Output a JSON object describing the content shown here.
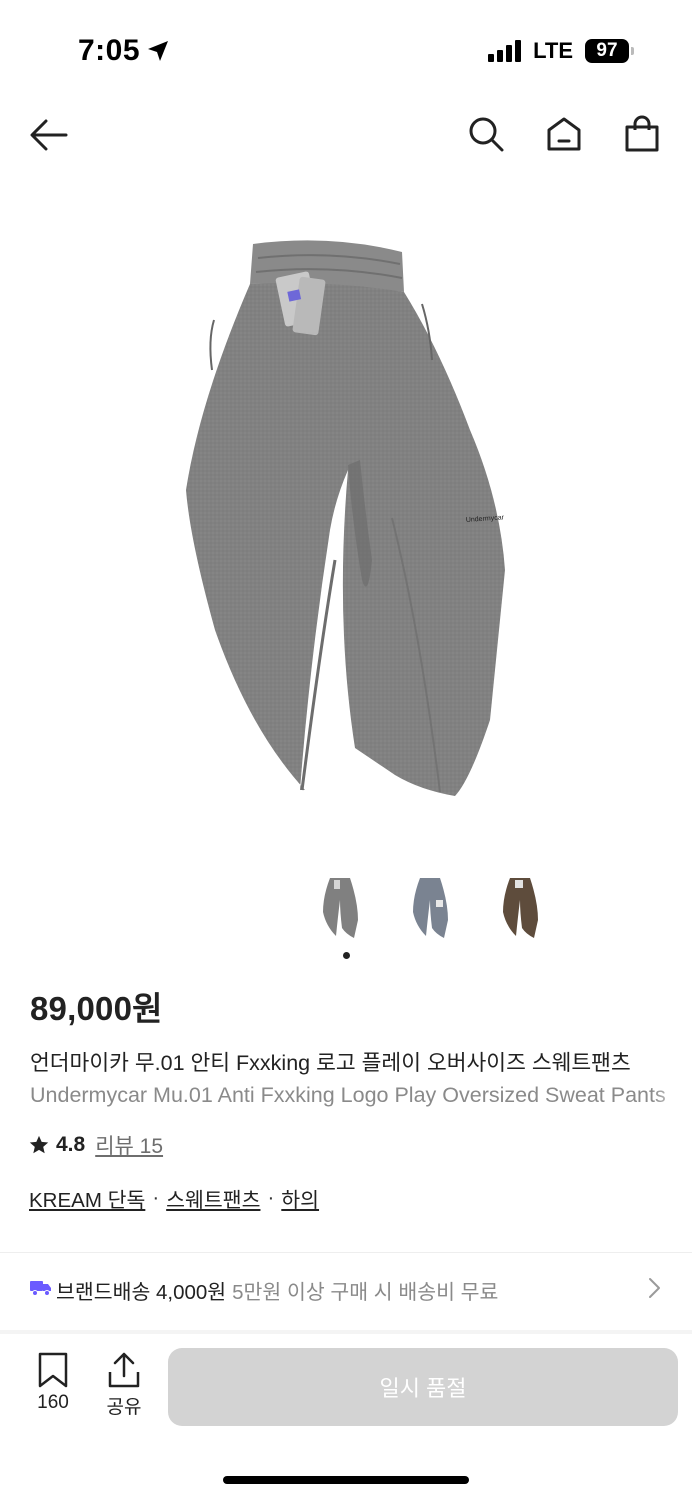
{
  "status_bar": {
    "time": "7:05",
    "network": "LTE",
    "battery": "97"
  },
  "nav": {
    "back_icon": "arrow-left-icon",
    "search_icon": "search-icon",
    "home_icon": "home-icon",
    "bag_icon": "shopping-bag-icon"
  },
  "product": {
    "images": [
      {
        "color": "#808080"
      },
      {
        "color": "#7a8391"
      },
      {
        "color": "#5e4c3c"
      }
    ],
    "active_image": 1,
    "price": "89,000원",
    "title_ko": "언더마이카 무.01 안티 Fxxking 로고 플레이 오버사이즈 스웨트팬츠",
    "title_en": "Undermycar Mu.01 Anti Fxxking Logo Play Oversized Sweat Pants",
    "rating": "4.8",
    "review_label": "리뷰 15",
    "tags": [
      "KREAM 단독",
      "스웨트팬츠",
      "하의"
    ],
    "tag_separator": "·"
  },
  "delivery": {
    "icon": "truck-icon",
    "label": "브랜드배송 4,000원",
    "note": "5만원 이상 구매 시 배송비 무료",
    "accent_color": "#6b5bff"
  },
  "bottom_bar": {
    "saved_count": "160",
    "share_label": "공유",
    "buy_button_label": "일시 품절"
  }
}
